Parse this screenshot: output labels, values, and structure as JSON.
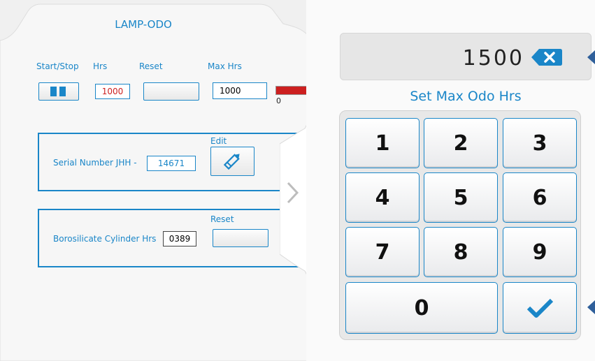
{
  "left_panel": {
    "title": "LAMP-ODO",
    "labels": {
      "start_stop": "Start/Stop",
      "hrs": "Hrs",
      "reset": "Reset",
      "max_hrs": "Max Hrs"
    },
    "hrs_value": "1000",
    "max_hrs_value": "1000",
    "gauge_zero": "0",
    "serial": {
      "label": "Serial Number JHH -",
      "value": "14671",
      "edit_label": "Edit"
    },
    "cylinder": {
      "label": "Borosilicate Cylinder Hrs",
      "value": "0389",
      "reset_label": "Reset"
    }
  },
  "keypad_panel": {
    "display_value": "1500",
    "set_label": "Set Max Odo Hrs",
    "keys": [
      "1",
      "2",
      "3",
      "4",
      "5",
      "6",
      "7",
      "8",
      "9",
      "0"
    ]
  },
  "colors": {
    "accent": "#1a86c8",
    "gauge": "#cc1f1f",
    "hrs_text": "#cc1f1f",
    "side_arrow": "#2f5f9a"
  },
  "icons": {
    "pause": "pause-icon",
    "edit": "pencil-icon",
    "backspace": "backspace-icon",
    "confirm": "checkmark-icon",
    "expand": "chevron-right-icon"
  }
}
